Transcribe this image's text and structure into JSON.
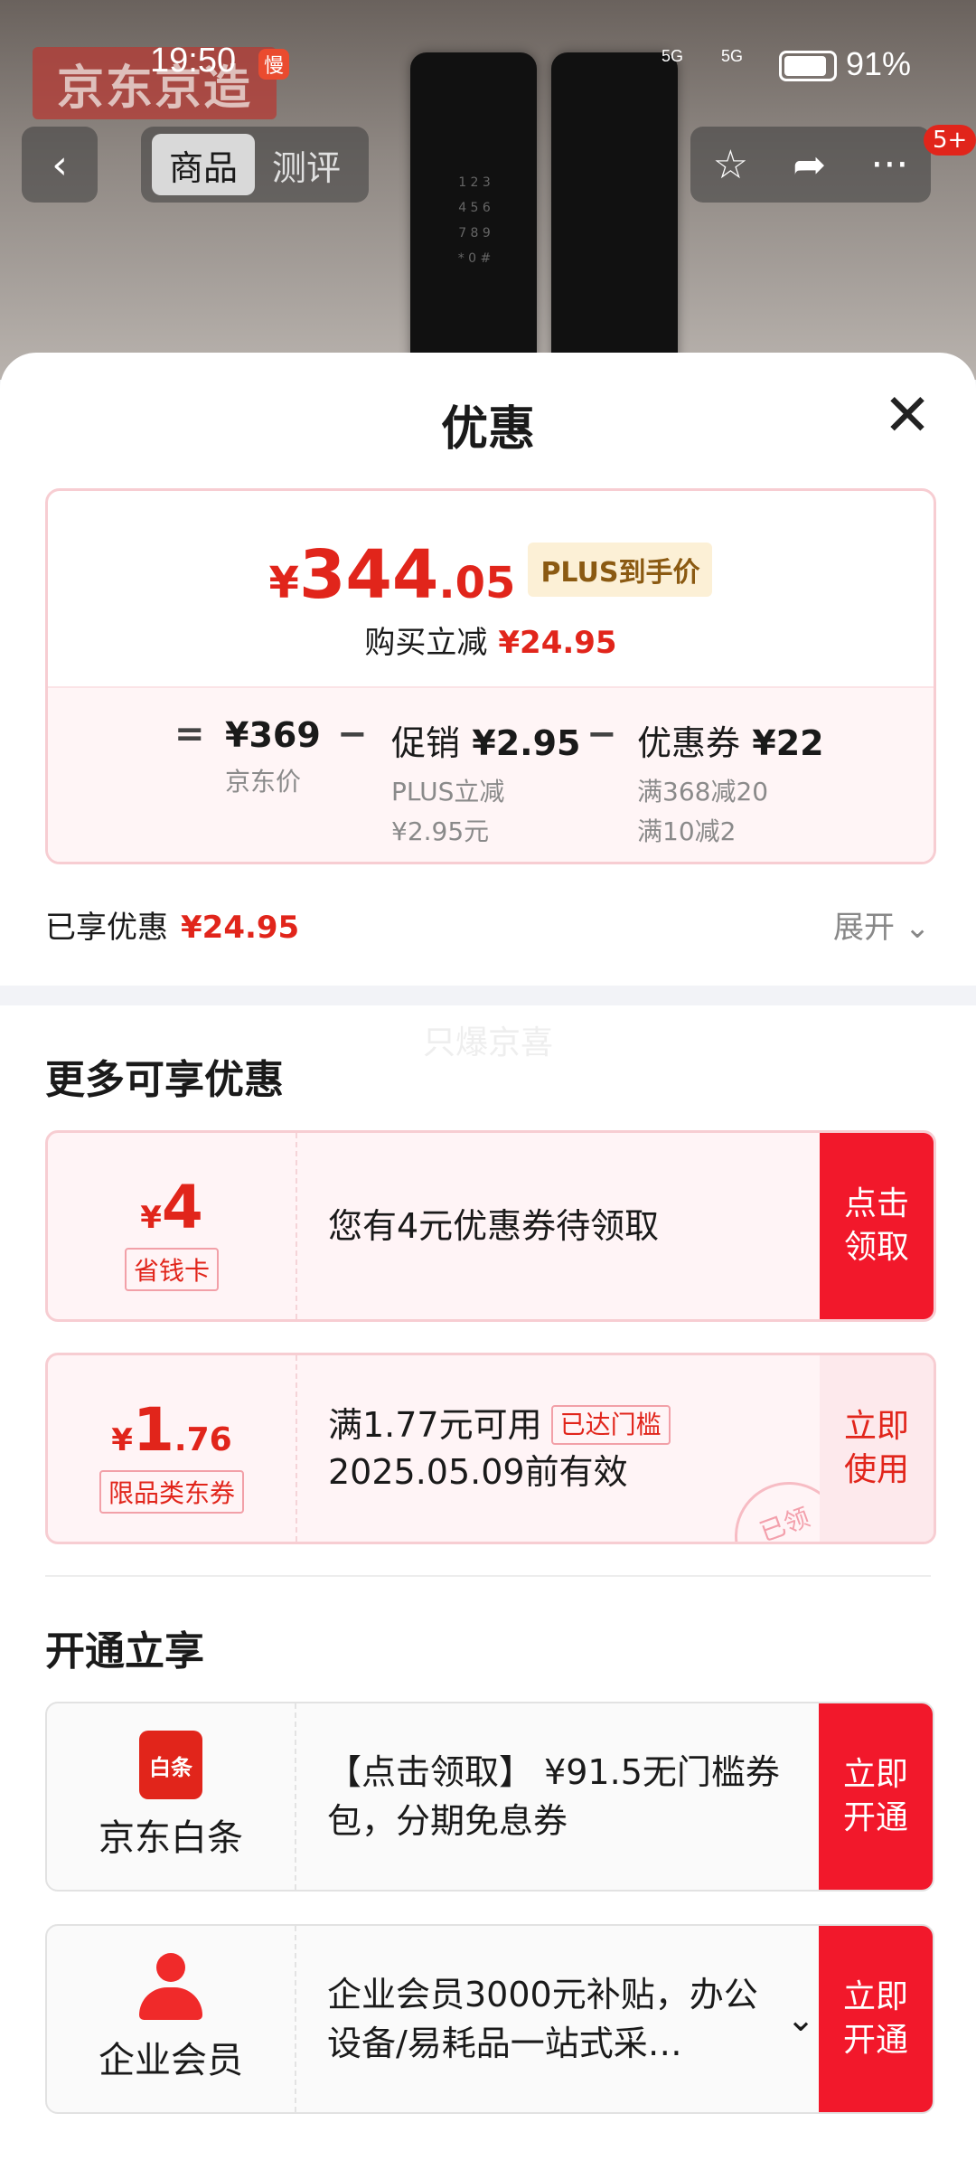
{
  "status_bar": {
    "time": "19:50",
    "slow_badge": "慢",
    "signal1": "5G",
    "signal2": "5G",
    "battery_pct": "91%"
  },
  "header": {
    "brand_logo": "京东京造",
    "tabs": [
      {
        "label": "商品",
        "active": true
      },
      {
        "label": "测评",
        "active": false
      }
    ],
    "message_badge": "5+"
  },
  "sheet": {
    "title": "优惠",
    "price": {
      "yen": "¥",
      "integer": "344",
      "decimal": ".05",
      "plus_tag": "PLUS到手价",
      "reduce_label": "购买立减",
      "reduce_value": "¥24.95"
    },
    "breakdown": {
      "eq": "=",
      "jd_price": "¥369",
      "jd_price_label": "京东价",
      "minus1": "−",
      "promo_label": "促销",
      "promo_value": "¥2.95",
      "promo_sub1": "PLUS立减",
      "promo_sub2": "¥2.95元",
      "minus2": "−",
      "coupon_label": "优惠券",
      "coupon_value": "¥22",
      "coupon_sub1": "满368减20",
      "coupon_sub2": "满10减2"
    },
    "enjoyed_label": "已享优惠",
    "enjoyed_value": "¥24.95",
    "expand_label": "展开"
  },
  "watermark": "只爆京喜",
  "more_offers": {
    "title": "更多可享优惠",
    "coupons": [
      {
        "yen": "¥",
        "amount": "4",
        "decimal": "",
        "tag": "省钱卡",
        "text": "您有4元优惠券待领取",
        "text2": "",
        "threshold": "",
        "action_line1": "点击",
        "action_line2": "领取"
      },
      {
        "yen": "¥",
        "amount": "1",
        "decimal": ".76",
        "tag": "限品类东券",
        "text": "满1.77元可用",
        "text2": "2025.05.09前有效",
        "threshold": "已达门槛",
        "action_line1": "立即",
        "action_line2": "使用",
        "stamp": "已领"
      }
    ]
  },
  "open_benefits": {
    "title": "开通立享",
    "items": [
      {
        "icon_text": "白条",
        "name": "京东白条",
        "desc": "【点击领取】 ¥91.5无门槛券包，分期免息券",
        "action_line1": "立即",
        "action_line2": "开通"
      },
      {
        "name": "企业会员",
        "desc": "企业会员3000元补贴，办公设备/易耗品一站式采…",
        "action_line1": "立即",
        "action_line2": "开通"
      }
    ]
  }
}
